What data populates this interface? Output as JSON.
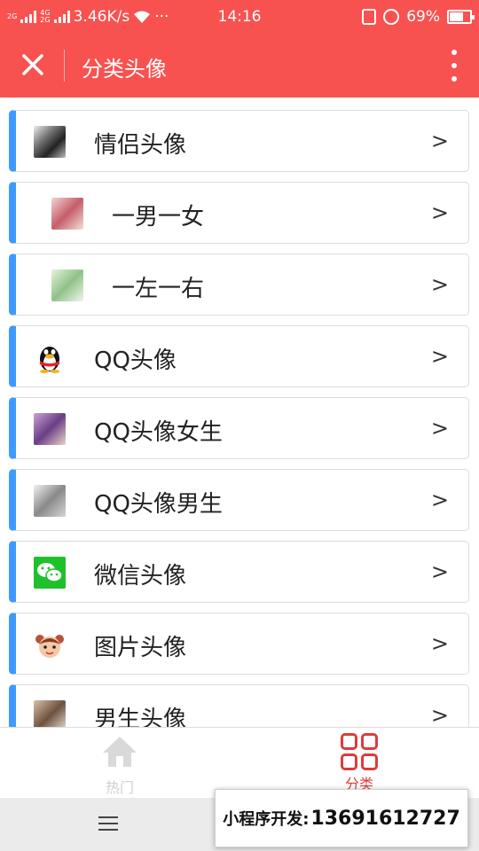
{
  "status_bar": {
    "net_top": "2G",
    "net_mid": "4G",
    "net_low": "2G",
    "speed": "3.46K/s",
    "wifi_icon": "wifi-icon",
    "more": "···",
    "time": "14:16",
    "battery_percent": "69%",
    "battery_level": 0.69
  },
  "header": {
    "title": "分类头像",
    "background_color": "#f85250"
  },
  "categories": [
    {
      "label": "情侣头像",
      "chevron": ">"
    },
    {
      "label": "一男一女",
      "chevron": ">"
    },
    {
      "label": "一左一右",
      "chevron": ">"
    },
    {
      "label": "QQ头像",
      "chevron": ">"
    },
    {
      "label": "QQ头像女生",
      "chevron": ">"
    },
    {
      "label": "QQ头像男生",
      "chevron": ">"
    },
    {
      "label": "微信头像",
      "chevron": ">"
    },
    {
      "label": "图片头像",
      "chevron": ">"
    },
    {
      "label": "男生头像",
      "chevron": ">"
    }
  ],
  "accent_color": "#3d9bff",
  "tabs": [
    {
      "label": "热门",
      "icon": "home-icon",
      "active": false
    },
    {
      "label": "分类",
      "icon": "grid-icon",
      "active": true
    }
  ],
  "active_tab_color": "#e03a3a",
  "badge": {
    "label": "小程序开发:",
    "phone": "13691612727"
  }
}
